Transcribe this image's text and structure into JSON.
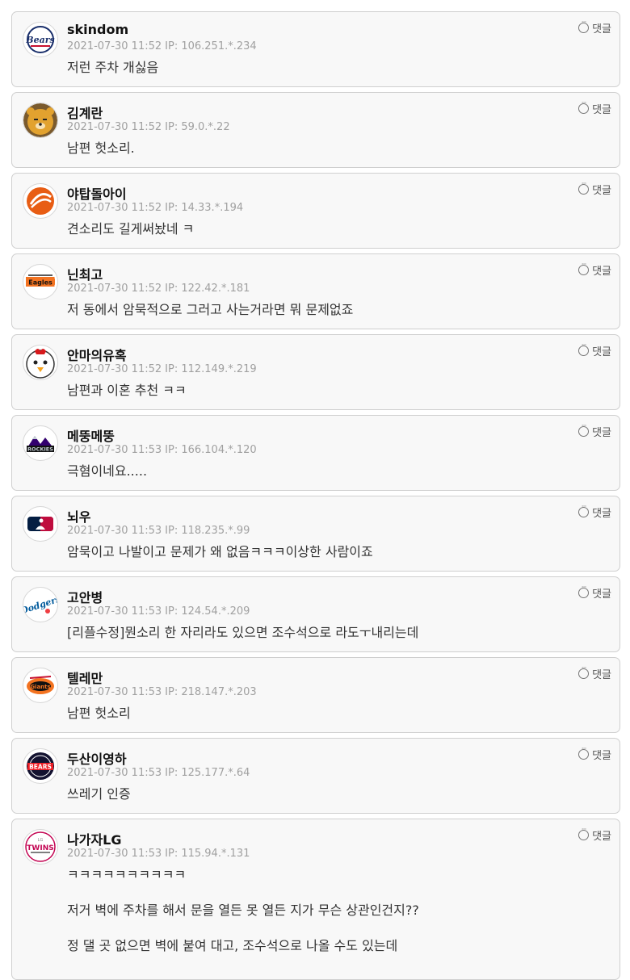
{
  "reply_label": "댓글",
  "comments": [
    {
      "nick": "skindom",
      "date": "2021-07-30 11:52",
      "ip": "IP: 106.251.*.234",
      "body": "저런 주차 개싫음",
      "emblem": "bears-script"
    },
    {
      "nick": "김계란",
      "date": "2021-07-30 11:52",
      "ip": "IP: 59.0.*.22",
      "body": "남편 헛소리.",
      "emblem": "bear-face"
    },
    {
      "nick": "야탑돌아이",
      "date": "2021-07-30 11:52",
      "ip": "IP: 14.33.*.194",
      "body": "견소리도 길게써놨네 ㅋ",
      "emblem": "orange-swirl"
    },
    {
      "nick": "닌최고",
      "date": "2021-07-30 11:52",
      "ip": "IP: 122.42.*.181",
      "body": "저 동에서 암묵적으로 그러고 사는거라면 뭐 문제없죠",
      "emblem": "eagles"
    },
    {
      "nick": "안마의유혹",
      "date": "2021-07-30 11:52",
      "ip": "IP: 112.149.*.219",
      "body": "남편과 이혼 추천 ㅋㅋ",
      "emblem": "chicken-face"
    },
    {
      "nick": "메뚱메뚱",
      "date": "2021-07-30 11:53",
      "ip": "IP: 166.104.*.120",
      "body": "극혐이네요.....",
      "emblem": "rockies"
    },
    {
      "nick": "뇌우",
      "date": "2021-07-30 11:53",
      "ip": "IP: 118.235.*.99",
      "body": "암묵이고 나발이고 문제가 왜 없음ㅋㅋㅋ이상한 사람이죠",
      "emblem": "mlb"
    },
    {
      "nick": "고안병",
      "date": "2021-07-30 11:53",
      "ip": "IP: 124.54.*.209",
      "body": "[리플수정]뭔소리 한 자리라도 있으면 조수석으로 라도ㅜ내리는데",
      "emblem": "dodgers"
    },
    {
      "nick": "텔레만",
      "date": "2021-07-30 11:53",
      "ip": "IP: 218.147.*.203",
      "body": "남편 헛소리",
      "emblem": "giants"
    },
    {
      "nick": "두산이영하",
      "date": "2021-07-30 11:53",
      "ip": "IP: 125.177.*.64",
      "body": "쓰레기 인증",
      "emblem": "doosan-bears"
    },
    {
      "nick": "나가자LG",
      "date": "2021-07-30 11:53",
      "ip": "IP: 115.94.*.131",
      "body": "ㅋㅋㅋㅋㅋㅋㅋㅋㅋㅋ\n\n저거 벽에 주차를 해서 문을 열든 못 열든 지가 무슨 상관인건지??\n\n정 댈 곳 없으면 벽에 붙여 대고, 조수석으로 나올 수도 있는데",
      "emblem": "lg-twins"
    }
  ]
}
